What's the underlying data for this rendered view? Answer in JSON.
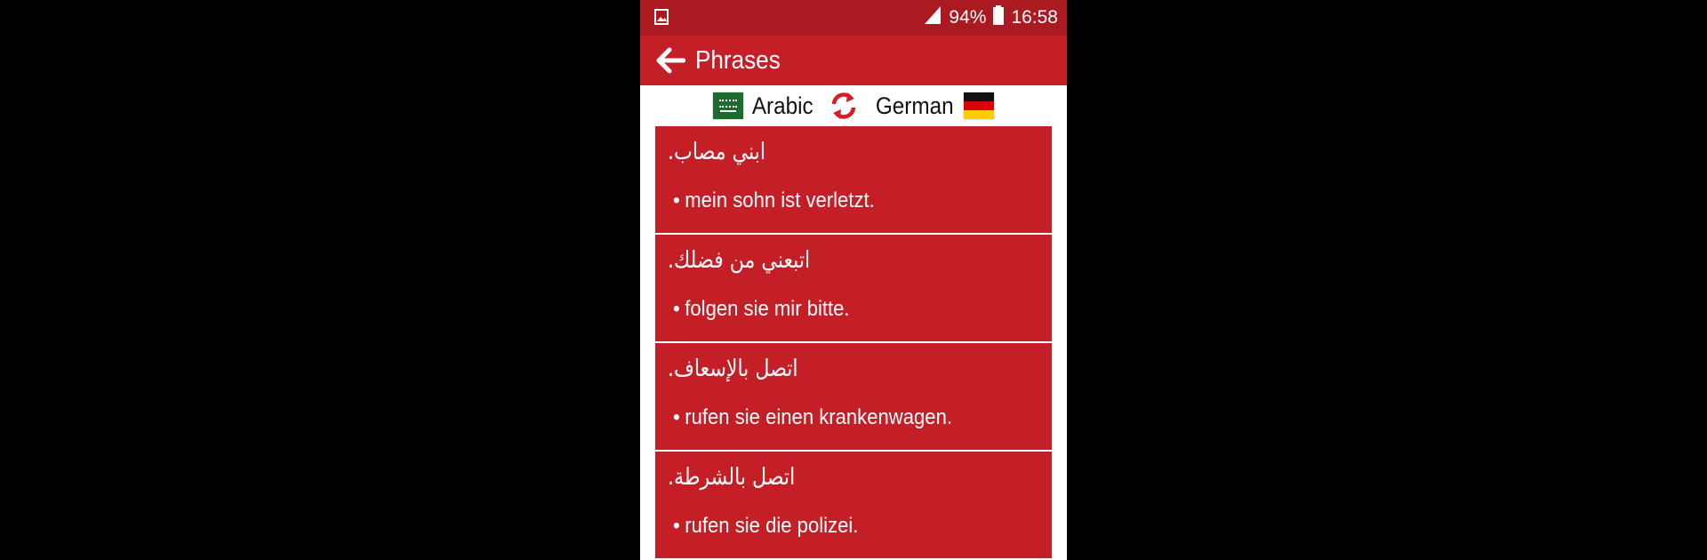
{
  "status_bar": {
    "battery": "94%",
    "time": "16:58"
  },
  "app_bar": {
    "title": "Phrases"
  },
  "languages": {
    "source": "Arabic",
    "target": "German"
  },
  "phrases": [
    {
      "arabic": "ابني مصاب.",
      "german": "mein sohn ist verletzt."
    },
    {
      "arabic": "اتبعني من فضلك.",
      "german": "folgen sie mir bitte."
    },
    {
      "arabic": "اتصل بالإسعاف.",
      "german": "rufen sie einen krankenwagen."
    },
    {
      "arabic": "اتصل بالشرطة.",
      "german": "rufen sie die polizei."
    }
  ],
  "colors": {
    "status_bar": "#ab1a21",
    "primary": "#c41e26",
    "background": "#ffffff",
    "outside": "#000000"
  },
  "icons": {
    "status_left": "image-icon",
    "signal": "signal-icon",
    "battery": "battery-icon",
    "back": "arrow-left-icon",
    "swap": "swap-icon"
  }
}
